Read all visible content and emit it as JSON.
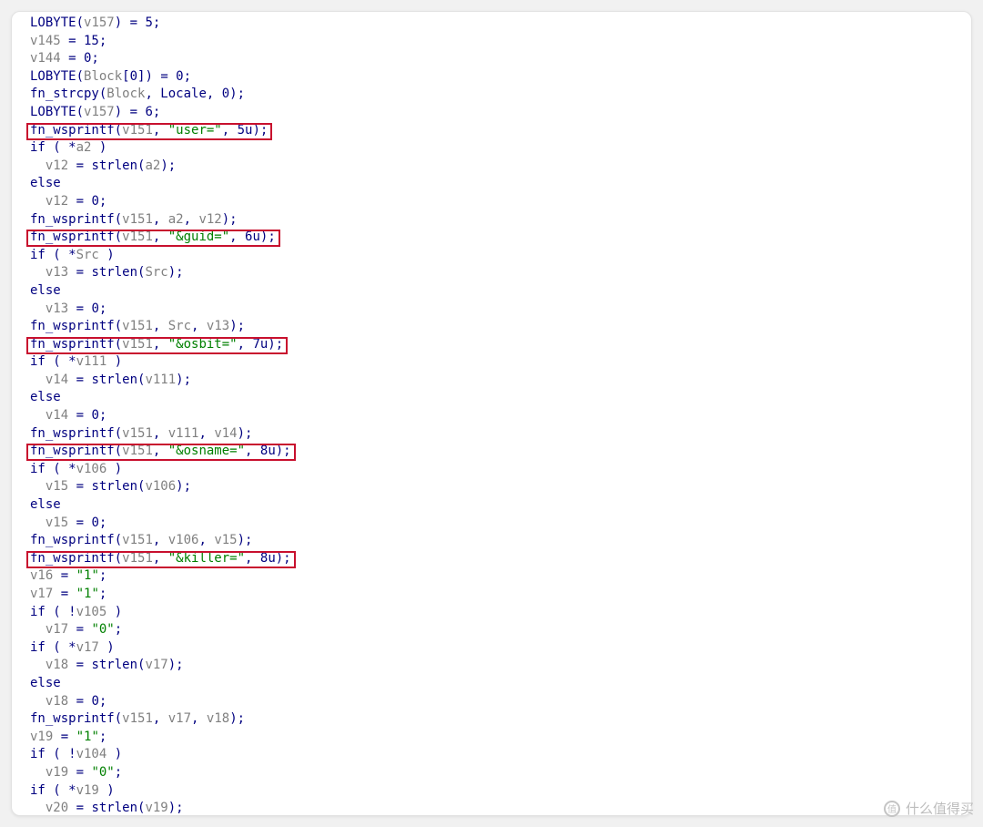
{
  "code_lines": [
    [
      {
        "t": "LOBYTE(",
        "c": "fn"
      },
      {
        "t": "v157",
        "c": "var"
      },
      {
        "t": ") = 5;",
        "c": "fn"
      }
    ],
    [
      {
        "t": "v145",
        "c": "var"
      },
      {
        "t": " = 15;",
        "c": "fn"
      }
    ],
    [
      {
        "t": "v144",
        "c": "var"
      },
      {
        "t": " = 0;",
        "c": "fn"
      }
    ],
    [
      {
        "t": "LOBYTE(",
        "c": "fn"
      },
      {
        "t": "Block",
        "c": "var"
      },
      {
        "t": "[0]) = 0;",
        "c": "fn"
      }
    ],
    [
      {
        "t": "fn_strcpy(",
        "c": "fn"
      },
      {
        "t": "Block",
        "c": "var"
      },
      {
        "t": ", Locale, 0);",
        "c": "fn"
      }
    ],
    [
      {
        "t": "LOBYTE(",
        "c": "fn"
      },
      {
        "t": "v157",
        "c": "var"
      },
      {
        "t": ") = 6;",
        "c": "fn"
      }
    ],
    [
      {
        "t": "fn_wsprintf(",
        "c": "fn"
      },
      {
        "t": "v151",
        "c": "var"
      },
      {
        "t": ", ",
        "c": "fn"
      },
      {
        "t": "\"user=\"",
        "c": "str"
      },
      {
        "t": ", 5u);",
        "c": "fn"
      }
    ],
    [
      {
        "t": "if ( *",
        "c": "kw"
      },
      {
        "t": "a2",
        "c": "var"
      },
      {
        "t": " )",
        "c": "kw"
      }
    ],
    [
      {
        "t": "  ",
        "c": "fn"
      },
      {
        "t": "v12",
        "c": "var"
      },
      {
        "t": " = strlen(",
        "c": "fn"
      },
      {
        "t": "a2",
        "c": "var"
      },
      {
        "t": ");",
        "c": "fn"
      }
    ],
    [
      {
        "t": "else",
        "c": "kw"
      }
    ],
    [
      {
        "t": "  ",
        "c": "fn"
      },
      {
        "t": "v12",
        "c": "var"
      },
      {
        "t": " = 0;",
        "c": "fn"
      }
    ],
    [
      {
        "t": "fn_wsprintf(",
        "c": "fn"
      },
      {
        "t": "v151",
        "c": "var"
      },
      {
        "t": ", ",
        "c": "fn"
      },
      {
        "t": "a2",
        "c": "var"
      },
      {
        "t": ", ",
        "c": "fn"
      },
      {
        "t": "v12",
        "c": "var"
      },
      {
        "t": ");",
        "c": "fn"
      }
    ],
    [
      {
        "t": "fn_wsprintf(",
        "c": "fn"
      },
      {
        "t": "v151",
        "c": "var"
      },
      {
        "t": ", ",
        "c": "fn"
      },
      {
        "t": "\"&guid=\"",
        "c": "str"
      },
      {
        "t": ", 6u);",
        "c": "fn"
      }
    ],
    [
      {
        "t": "if ( *",
        "c": "kw"
      },
      {
        "t": "Src",
        "c": "var"
      },
      {
        "t": " )",
        "c": "kw"
      }
    ],
    [
      {
        "t": "  ",
        "c": "fn"
      },
      {
        "t": "v13",
        "c": "var"
      },
      {
        "t": " = strlen(",
        "c": "fn"
      },
      {
        "t": "Src",
        "c": "var"
      },
      {
        "t": ");",
        "c": "fn"
      }
    ],
    [
      {
        "t": "else",
        "c": "kw"
      }
    ],
    [
      {
        "t": "  ",
        "c": "fn"
      },
      {
        "t": "v13",
        "c": "var"
      },
      {
        "t": " = 0;",
        "c": "fn"
      }
    ],
    [
      {
        "t": "fn_wsprintf(",
        "c": "fn"
      },
      {
        "t": "v151",
        "c": "var"
      },
      {
        "t": ", ",
        "c": "fn"
      },
      {
        "t": "Src",
        "c": "var"
      },
      {
        "t": ", ",
        "c": "fn"
      },
      {
        "t": "v13",
        "c": "var"
      },
      {
        "t": ");",
        "c": "fn"
      }
    ],
    [
      {
        "t": "fn_wsprintf(",
        "c": "fn"
      },
      {
        "t": "v151",
        "c": "var"
      },
      {
        "t": ", ",
        "c": "fn"
      },
      {
        "t": "\"&osbit=\"",
        "c": "str"
      },
      {
        "t": ", 7u);",
        "c": "fn"
      }
    ],
    [
      {
        "t": "if ( *",
        "c": "kw"
      },
      {
        "t": "v111",
        "c": "var"
      },
      {
        "t": " )",
        "c": "kw"
      }
    ],
    [
      {
        "t": "  ",
        "c": "fn"
      },
      {
        "t": "v14",
        "c": "var"
      },
      {
        "t": " = strlen(",
        "c": "fn"
      },
      {
        "t": "v111",
        "c": "var"
      },
      {
        "t": ");",
        "c": "fn"
      }
    ],
    [
      {
        "t": "else",
        "c": "kw"
      }
    ],
    [
      {
        "t": "  ",
        "c": "fn"
      },
      {
        "t": "v14",
        "c": "var"
      },
      {
        "t": " = 0;",
        "c": "fn"
      }
    ],
    [
      {
        "t": "fn_wsprintf(",
        "c": "fn"
      },
      {
        "t": "v151",
        "c": "var"
      },
      {
        "t": ", ",
        "c": "fn"
      },
      {
        "t": "v111",
        "c": "var"
      },
      {
        "t": ", ",
        "c": "fn"
      },
      {
        "t": "v14",
        "c": "var"
      },
      {
        "t": ");",
        "c": "fn"
      }
    ],
    [
      {
        "t": "fn_wsprintf(",
        "c": "fn"
      },
      {
        "t": "v151",
        "c": "var"
      },
      {
        "t": ", ",
        "c": "fn"
      },
      {
        "t": "\"&osname=\"",
        "c": "str"
      },
      {
        "t": ", 8u);",
        "c": "fn"
      }
    ],
    [
      {
        "t": "if ( *",
        "c": "kw"
      },
      {
        "t": "v106",
        "c": "var"
      },
      {
        "t": " )",
        "c": "kw"
      }
    ],
    [
      {
        "t": "  ",
        "c": "fn"
      },
      {
        "t": "v15",
        "c": "var"
      },
      {
        "t": " = strlen(",
        "c": "fn"
      },
      {
        "t": "v106",
        "c": "var"
      },
      {
        "t": ");",
        "c": "fn"
      }
    ],
    [
      {
        "t": "else",
        "c": "kw"
      }
    ],
    [
      {
        "t": "  ",
        "c": "fn"
      },
      {
        "t": "v15",
        "c": "var"
      },
      {
        "t": " = 0;",
        "c": "fn"
      }
    ],
    [
      {
        "t": "fn_wsprintf(",
        "c": "fn"
      },
      {
        "t": "v151",
        "c": "var"
      },
      {
        "t": ", ",
        "c": "fn"
      },
      {
        "t": "v106",
        "c": "var"
      },
      {
        "t": ", ",
        "c": "fn"
      },
      {
        "t": "v15",
        "c": "var"
      },
      {
        "t": ");",
        "c": "fn"
      }
    ],
    [
      {
        "t": "fn_wsprintf(",
        "c": "fn"
      },
      {
        "t": "v151",
        "c": "var"
      },
      {
        "t": ", ",
        "c": "fn"
      },
      {
        "t": "\"&killer=\"",
        "c": "str"
      },
      {
        "t": ", 8u);",
        "c": "fn"
      }
    ],
    [
      {
        "t": "v16",
        "c": "var"
      },
      {
        "t": " = ",
        "c": "fn"
      },
      {
        "t": "\"1\"",
        "c": "str"
      },
      {
        "t": ";",
        "c": "fn"
      }
    ],
    [
      {
        "t": "v17",
        "c": "var"
      },
      {
        "t": " = ",
        "c": "fn"
      },
      {
        "t": "\"1\"",
        "c": "str"
      },
      {
        "t": ";",
        "c": "fn"
      }
    ],
    [
      {
        "t": "if ( !",
        "c": "kw"
      },
      {
        "t": "v105",
        "c": "var"
      },
      {
        "t": " )",
        "c": "kw"
      }
    ],
    [
      {
        "t": "  ",
        "c": "fn"
      },
      {
        "t": "v17",
        "c": "var"
      },
      {
        "t": " = ",
        "c": "fn"
      },
      {
        "t": "\"0\"",
        "c": "str"
      },
      {
        "t": ";",
        "c": "fn"
      }
    ],
    [
      {
        "t": "if ( *",
        "c": "kw"
      },
      {
        "t": "v17",
        "c": "var"
      },
      {
        "t": " )",
        "c": "kw"
      }
    ],
    [
      {
        "t": "  ",
        "c": "fn"
      },
      {
        "t": "v18",
        "c": "var"
      },
      {
        "t": " = strlen(",
        "c": "fn"
      },
      {
        "t": "v17",
        "c": "var"
      },
      {
        "t": ");",
        "c": "fn"
      }
    ],
    [
      {
        "t": "else",
        "c": "kw"
      }
    ],
    [
      {
        "t": "  ",
        "c": "fn"
      },
      {
        "t": "v18",
        "c": "var"
      },
      {
        "t": " = 0;",
        "c": "fn"
      }
    ],
    [
      {
        "t": "fn_wsprintf(",
        "c": "fn"
      },
      {
        "t": "v151",
        "c": "var"
      },
      {
        "t": ", ",
        "c": "fn"
      },
      {
        "t": "v17",
        "c": "var"
      },
      {
        "t": ", ",
        "c": "fn"
      },
      {
        "t": "v18",
        "c": "var"
      },
      {
        "t": ");",
        "c": "fn"
      }
    ],
    [
      {
        "t": "v19",
        "c": "var"
      },
      {
        "t": " = ",
        "c": "fn"
      },
      {
        "t": "\"1\"",
        "c": "str"
      },
      {
        "t": ";",
        "c": "fn"
      }
    ],
    [
      {
        "t": "if ( !",
        "c": "kw"
      },
      {
        "t": "v104",
        "c": "var"
      },
      {
        "t": " )",
        "c": "kw"
      }
    ],
    [
      {
        "t": "  ",
        "c": "fn"
      },
      {
        "t": "v19",
        "c": "var"
      },
      {
        "t": " = ",
        "c": "fn"
      },
      {
        "t": "\"0\"",
        "c": "str"
      },
      {
        "t": ";",
        "c": "fn"
      }
    ],
    [
      {
        "t": "if ( *",
        "c": "kw"
      },
      {
        "t": "v19",
        "c": "var"
      },
      {
        "t": " )",
        "c": "kw"
      }
    ],
    [
      {
        "t": "  ",
        "c": "fn"
      },
      {
        "t": "v20",
        "c": "var"
      },
      {
        "t": " = strlen(",
        "c": "fn"
      },
      {
        "t": "v19",
        "c": "var"
      },
      {
        "t": ");",
        "c": "fn"
      }
    ]
  ],
  "highlighted_lines": [
    6,
    12,
    18,
    24,
    30
  ],
  "colors": {
    "identifier": "#000080",
    "variable": "#808080",
    "string": "#008000",
    "highlight_border": "#c8102e"
  },
  "watermark": {
    "icon": "zhide-value-icon",
    "icon_glyph": "值",
    "text": "什么值得买"
  }
}
